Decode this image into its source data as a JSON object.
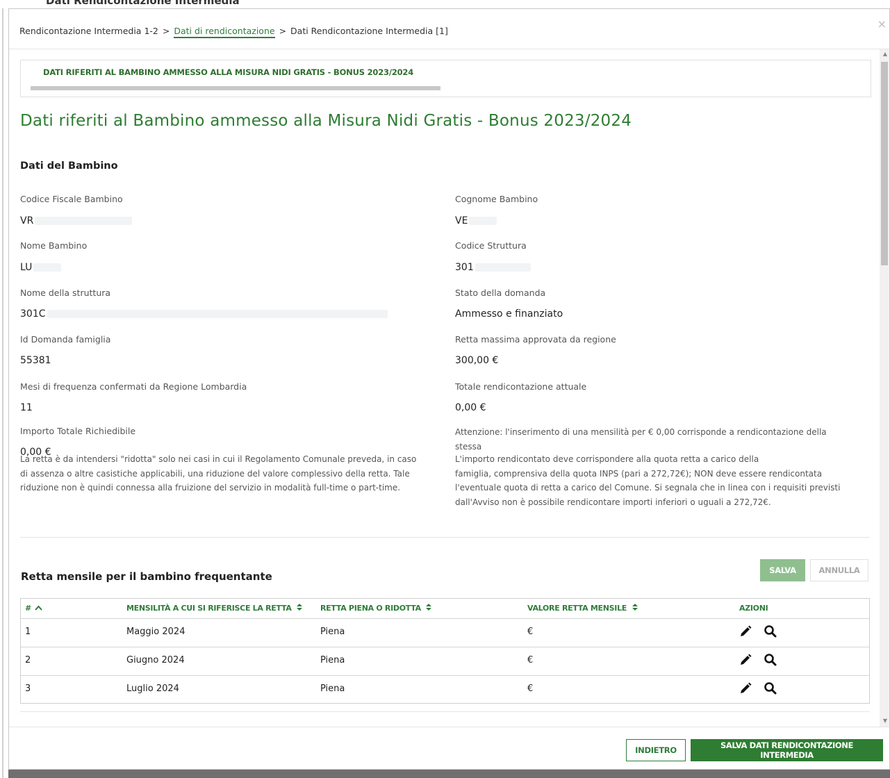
{
  "background": {
    "title": "Dati Rendicontazione Intermedia"
  },
  "breadcrumb": {
    "item1": "Rendicontazione Intermedia 1-2",
    "item2": "Dati di rendicontazione",
    "item3": "Dati Rendicontazione Intermedia [1]",
    "separator": ">"
  },
  "close_icon": "×",
  "section_box": {
    "label": "DATI RIFERITI AL BAMBINO AMMESSO ALLA MISURA NIDI GRATIS - BONUS 2023/2024"
  },
  "page_title": "Dati riferiti al Bambino ammesso alla Misura Nidi Gratis - Bonus 2023/2024",
  "subsection_title": "Dati del Bambino",
  "fields": {
    "codice_fiscale": {
      "label": "Codice Fiscale Bambino",
      "value": "VR"
    },
    "cognome": {
      "label": "Cognome Bambino",
      "value": "VE"
    },
    "nome": {
      "label": "Nome Bambino",
      "value": "LU"
    },
    "codice_struttura": {
      "label": "Codice Struttura",
      "value": "301"
    },
    "nome_struttura": {
      "label": "Nome della struttura",
      "value": "301C"
    },
    "stato_domanda": {
      "label": "Stato della domanda",
      "value": "Ammesso e finanziato"
    },
    "id_domanda": {
      "label": "Id Domanda famiglia",
      "value": "55381"
    },
    "retta_massima": {
      "label": "Retta massima approvata da regione",
      "value": "300,00 €"
    },
    "mesi_frequenza": {
      "label": "Mesi di frequenza confermati da Regione Lombardia",
      "value": "11"
    },
    "totale_rendicontazione": {
      "label": "Totale rendicontazione attuale",
      "value": "0,00 €"
    },
    "importo_totale": {
      "label": "Importo Totale Richiedibile",
      "value": "0,00 €"
    }
  },
  "notes": {
    "attenzione_line1": "Attenzione: l'inserimento di una mensilità per € 0,00 corrisponde a rendicontazione della",
    "attenzione_line2": "stessa",
    "ridotta_line1": "La retta è da intendersi \"ridotta\" solo nei casi in cui il Regolamento Comunale preveda, in caso",
    "ridotta_line2": "di assenza o altre casistiche applicabili, una riduzione del valore complessivo della retta. Tale",
    "ridotta_line3": "riduzione non è quindi connessa alla fruizione del servizio in modalità full-time o part-time.",
    "importo_line1": "L'importo rendicontato deve corrispondere alla quota retta a carico della",
    "importo_line2": "famiglia, comprensiva della quota INPS (pari a 272,72€); NON deve essere rendicontata",
    "importo_line3": "l'eventuale quota di retta a carico del Comune. Si segnala che in linea con i requisiti previsti",
    "importo_line4": "dall'Avviso non è possibile rendicontare importi inferiori o uguali a 272,72€."
  },
  "table_section": {
    "title": "Retta mensile per il bambino frequentante",
    "salva_label": "SALVA",
    "annulla_label": "ANNULLA",
    "headers": {
      "num": "#",
      "mensilita": "MENSILITÀ A CUI SI RIFERISCE LA RETTA",
      "retta": "RETTA PIENA O RIDOTTA",
      "valore": "VALORE RETTA MENSILE",
      "azioni": "AZIONI"
    },
    "rows": [
      {
        "num": "1",
        "mensilita": "Maggio 2024",
        "retta": "Piena",
        "valore": "€"
      },
      {
        "num": "2",
        "mensilita": "Giugno 2024",
        "retta": "Piena",
        "valore": "€"
      },
      {
        "num": "3",
        "mensilita": "Luglio 2024",
        "retta": "Piena",
        "valore": "€"
      }
    ]
  },
  "footer": {
    "indietro_label": "INDIETRO",
    "salva_dati_label": "SALVA DATI RENDICONTAZIONE INTERMEDIA"
  },
  "colors": {
    "primary_green": "#2e7d32",
    "light_green": "#8fbf8f",
    "header_green": "#2f7d3a"
  },
  "icons": [
    "close-icon",
    "sort-asc-icon",
    "sort-icon",
    "pencil-icon",
    "search-icon"
  ]
}
